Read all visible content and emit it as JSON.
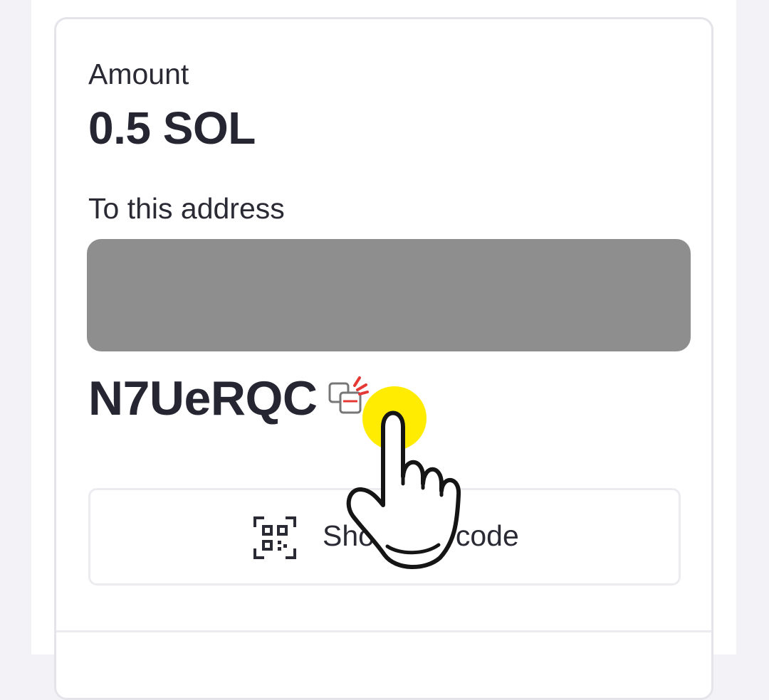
{
  "payment": {
    "amount_label": "Amount",
    "amount_value": "0.5 SOL",
    "address_label": "To this address",
    "address_suffix": "N7UeRQC"
  },
  "actions": {
    "copy_icon": "copy-icon",
    "qr_icon": "qr-code-icon",
    "qr_button_label": "Show QR code"
  },
  "overlay": {
    "tap_indicator": "tap-hand-icon",
    "highlight_color": "#ffec00"
  },
  "colors": {
    "text": "#262633",
    "redaction": "#8e8e8e",
    "copy_accent": "#e53935"
  }
}
